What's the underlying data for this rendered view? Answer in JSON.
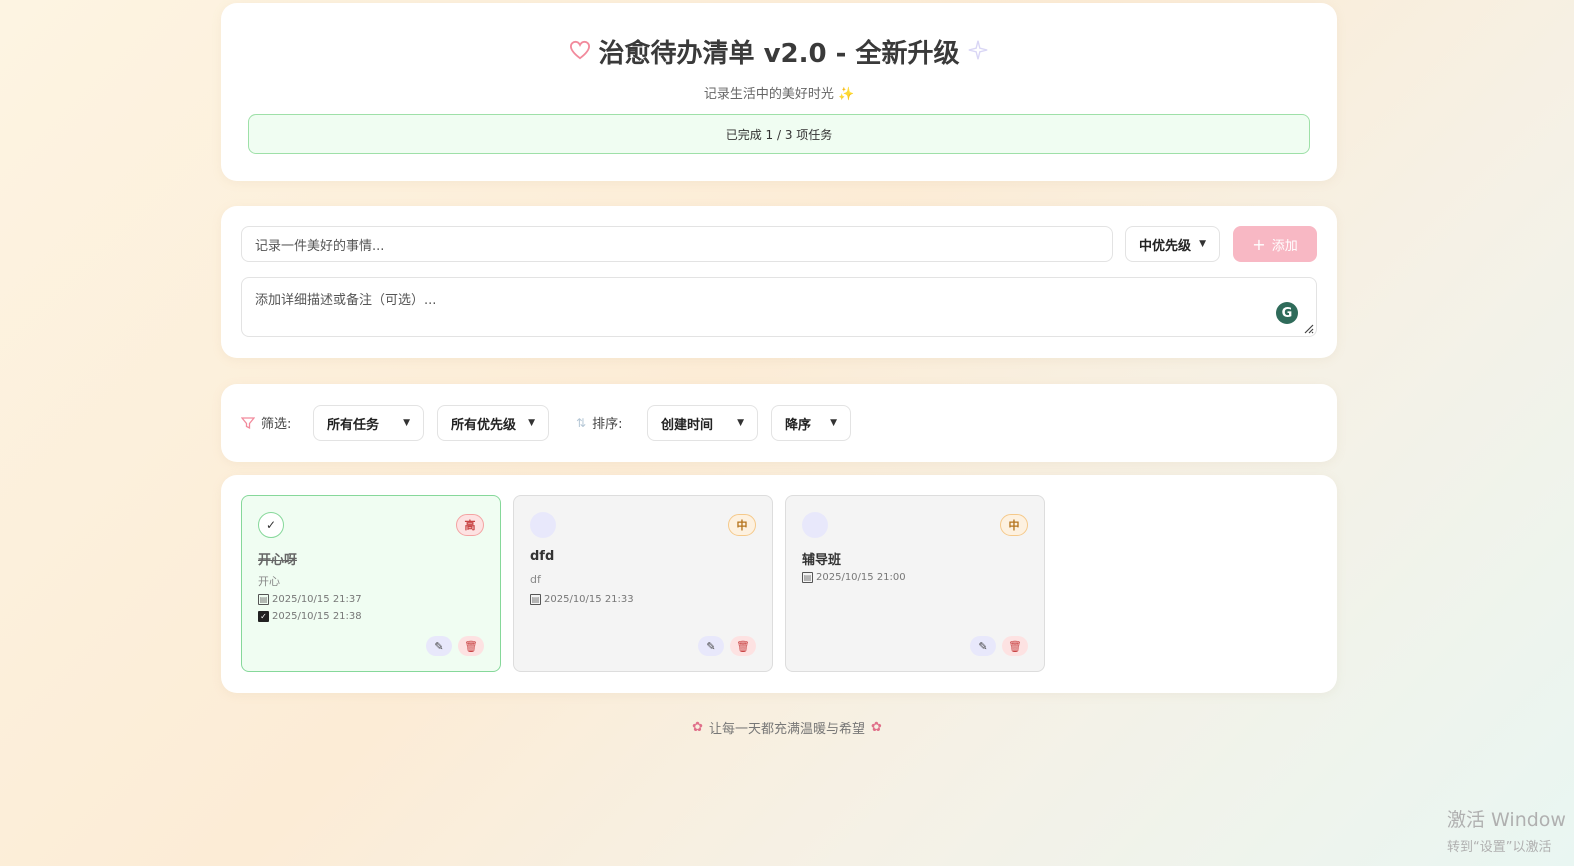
{
  "header": {
    "title": "治愈待办清单 v2.0 - 全新升级",
    "subtitle": "记录生活中的美好时光",
    "progress_text": "已完成 1 / 3 项任务"
  },
  "add_form": {
    "task_placeholder": "记录一件美好的事情...",
    "priority_selected": "中优先级",
    "add_label": "添加",
    "desc_placeholder": "添加详细描述或备注（可选）..."
  },
  "filters": {
    "filter_label": "筛选:",
    "status_selected": "所有任务",
    "priority_selected": "所有优先级",
    "sort_label": "排序:",
    "sort_field_selected": "创建时间",
    "sort_order_selected": "降序"
  },
  "tasks": [
    {
      "title": "开心呀",
      "description": "开心",
      "priority": "高",
      "done": true,
      "created": "2025/10/15 21:37",
      "completed": "2025/10/15 21:38"
    },
    {
      "title": "dfd",
      "description": "df",
      "priority": "中",
      "done": false,
      "created": "2025/10/15 21:33"
    },
    {
      "title": "辅导班",
      "description": "",
      "priority": "中",
      "done": false,
      "created": "2025/10/15 21:00"
    }
  ],
  "footer": {
    "text": "让每一天都充满温暖与希望"
  },
  "watermark": {
    "line1": "激活 Window",
    "line2": "转到“设置”以激活"
  },
  "colors": {
    "accent_pink": "#f8b8c4",
    "done_green": "#86d89a",
    "high_red": "#c94444",
    "mid_orange": "#b5741d"
  }
}
